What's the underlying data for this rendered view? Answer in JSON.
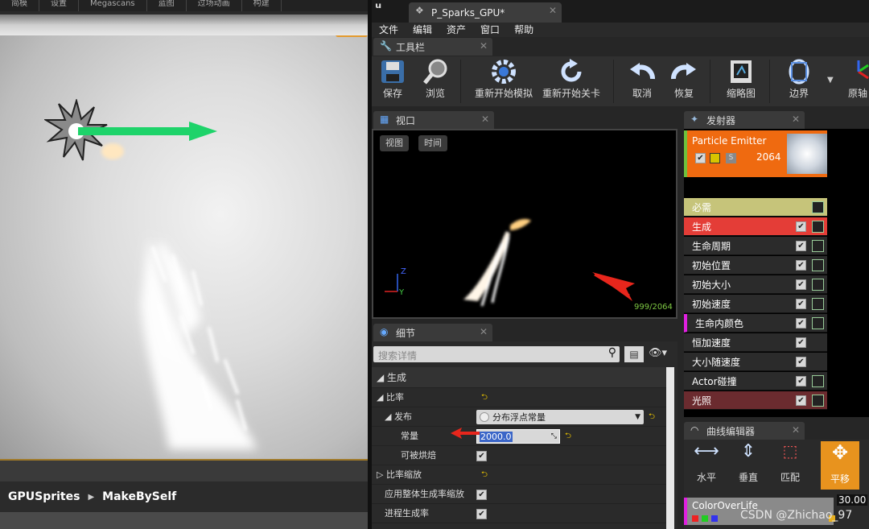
{
  "left": {
    "topbar": [
      "简模",
      "设置",
      "Megascans",
      "蓝图",
      "过场动画",
      "构建"
    ],
    "breadcrumb": [
      "GPUSprites",
      "MakeBySelf"
    ]
  },
  "window": {
    "doc_tab": "P_Sparks_GPU*"
  },
  "menu": [
    "文件",
    "编辑",
    "资产",
    "窗口",
    "帮助"
  ],
  "toolbar_tab": "工具栏",
  "toolbar": {
    "save": "保存",
    "browse": "浏览",
    "restart_sim": "重新开始模拟",
    "restart_level": "重新开始关卡",
    "undo": "取消",
    "redo": "恢复",
    "thumbnail": "缩略图",
    "bounds": "边界",
    "origin": "原轴"
  },
  "viewport": {
    "tab": "视口",
    "view_btn": "视图",
    "time_btn": "时间",
    "count": "999/2064",
    "axis_z": "Z",
    "axis_y": "Y"
  },
  "emitters": {
    "tab": "发射器",
    "emitter_name": "Particle Emitter",
    "emitter_count": "2064",
    "modules": [
      "必需",
      "生成",
      "生命周期",
      "初始位置",
      "初始大小",
      "初始速度",
      "生命内颜色",
      "恒加速度",
      "大小随速度",
      "Actor碰撞",
      "光照"
    ]
  },
  "details": {
    "tab": "细节",
    "search_placeholder": "搜索详情",
    "category": "生成",
    "rate": "比率",
    "distribution": "发布",
    "distribution_value": "分布浮点常量",
    "constant": "常量",
    "constant_value": "2000.0",
    "bakeable": "可被烘焙",
    "rate_scale": "比率缩放",
    "apply_global": "应用整体生成率缩放",
    "process_rate": "进程生成率"
  },
  "curve_editor": {
    "tab": "曲线编辑器",
    "horizontal": "水平",
    "vertical": "垂直",
    "fit": "匹配",
    "pan": "平移",
    "track": "ColorOverLife",
    "value": "30.00"
  },
  "watermark": "CSDN @Zhichao_97"
}
